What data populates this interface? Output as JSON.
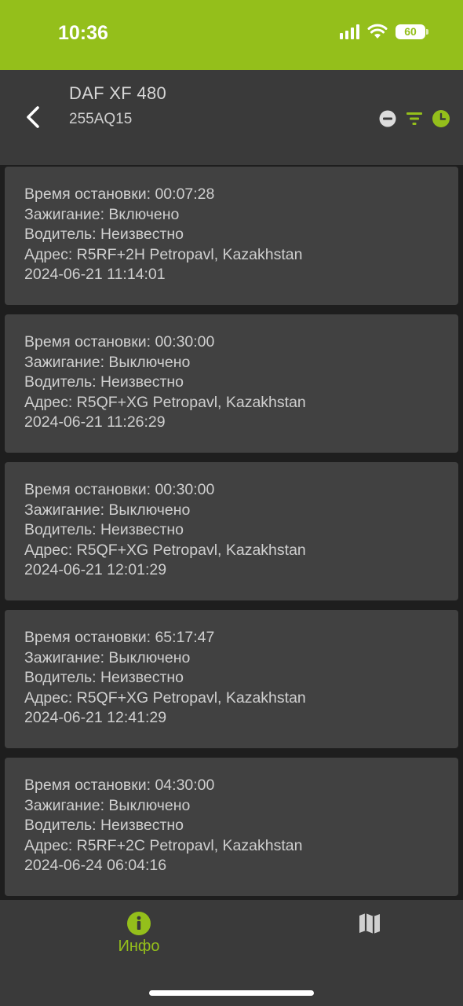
{
  "status_bar": {
    "time": "10:36",
    "battery": "60"
  },
  "header": {
    "title": "DAF XF 480",
    "plate": "255AQ15"
  },
  "stops": [
    {
      "duration": "Время остановки: 00:07:28",
      "ignition": "Зажигание: Включено",
      "driver": "Водитель: Неизвестно",
      "address": "Адрес: R5RF+2H Petropavl, Kazakhstan",
      "datetime": "2024-06-21 11:14:01"
    },
    {
      "duration": "Время остановки: 00:30:00",
      "ignition": "Зажигание: Выключено",
      "driver": "Водитель: Неизвестно",
      "address": "Адрес: R5QF+XG Petropavl, Kazakhstan",
      "datetime": "2024-06-21 11:26:29"
    },
    {
      "duration": "Время остановки: 00:30:00",
      "ignition": "Зажигание: Выключено",
      "driver": "Водитель: Неизвестно",
      "address": "Адрес: R5QF+XG Petropavl, Kazakhstan",
      "datetime": "2024-06-21 12:01:29"
    },
    {
      "duration": "Время остановки: 65:17:47",
      "ignition": "Зажигание: Выключено",
      "driver": "Водитель: Неизвестно",
      "address": "Адрес: R5QF+XG Petropavl, Kazakhstan",
      "datetime": "2024-06-21 12:41:29"
    },
    {
      "duration": "Время остановки: 04:30:00",
      "ignition": "Зажигание: Выключено",
      "driver": "Водитель: Неизвестно",
      "address": "Адрес: R5RF+2C Petropavl, Kazakhstan",
      "datetime": "2024-06-24 06:04:16"
    }
  ],
  "tabs": {
    "info": {
      "label": "Инфо",
      "icon": "info-icon"
    },
    "map": {
      "icon": "map-icon"
    }
  },
  "colors": {
    "accent": "#94bf1b",
    "header_bg": "#3a3a3a",
    "card_bg": "#414141",
    "page_bg": "#1e1e1e",
    "text": "#cfcfcf"
  }
}
